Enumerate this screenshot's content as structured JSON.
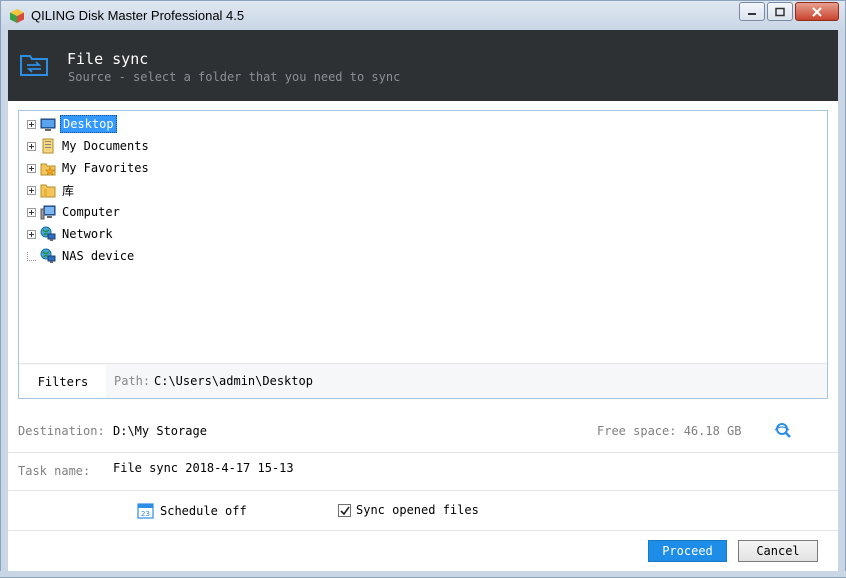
{
  "window": {
    "title": "QILING Disk Master Professional 4.5"
  },
  "header": {
    "title": "File sync",
    "subtitle": "Source - select a folder that you need to sync"
  },
  "tree": {
    "items": [
      {
        "label": "Desktop",
        "icon": "desktop-icon",
        "selected": true
      },
      {
        "label": "My Documents",
        "icon": "documents-icon"
      },
      {
        "label": "My Favorites",
        "icon": "favorites-icon"
      },
      {
        "label": "库",
        "icon": "library-folder-icon"
      },
      {
        "label": "Computer",
        "icon": "computer-icon"
      },
      {
        "label": "Network",
        "icon": "network-icon"
      },
      {
        "label": "NAS device",
        "icon": "nas-device-icon"
      }
    ]
  },
  "footer": {
    "filters_label": "Filters",
    "path_label": "Path:",
    "path_value": "C:\\Users\\admin\\Desktop"
  },
  "destination": {
    "label": "Destination:",
    "value": "D:\\My Storage",
    "free_space": "Free space: 46.18 GB"
  },
  "task": {
    "label": "Task name:",
    "value": "File sync 2018-4-17 15-13"
  },
  "options": {
    "schedule_label": "Schedule off",
    "sync_opened_label": "Sync opened files",
    "sync_opened_checked": true
  },
  "buttons": {
    "proceed": "Proceed",
    "cancel": "Cancel"
  },
  "colors": {
    "header_bg": "#2e3133",
    "accent": "#1e8de8",
    "selection": "#3399ff"
  }
}
